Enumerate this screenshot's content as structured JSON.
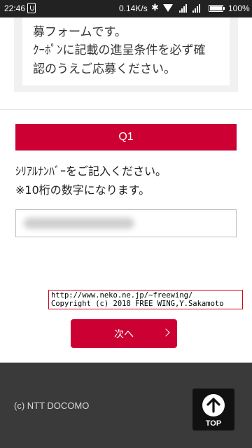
{
  "status_bar": {
    "time": "22:46",
    "network_speed": "0.14K/s",
    "battery": "100%",
    "icons": [
      "notification-icon",
      "bluetooth-icon",
      "wifi-icon",
      "signal-icon",
      "signal-icon",
      "battery-icon"
    ]
  },
  "notice": {
    "lines": [
      "募フォームです。",
      "ｸｰﾎﾟﾝに記載の進呈条件を必ず確",
      "認のうえご応募ください。"
    ]
  },
  "question": {
    "header": "Q1",
    "lines": [
      "ｼﾘｱﾙﾅﾝﾊﾞｰをご記入ください。",
      "※10桁の数字になります。"
    ],
    "input_placeholder": ""
  },
  "watermark": {
    "lines": [
      "http://www.neko.ne.jp/~freewing/",
      "Copyright (c) 2018 FREE WING,Y.Sakamoto"
    ]
  },
  "next_button": {
    "label": "次へ"
  },
  "footer": {
    "copyright": "(c) NTT DOCOMO",
    "top_label": "TOP"
  },
  "colors": {
    "accent": "#cc0033",
    "footer_bg": "#3a3a3a",
    "status_bar_bg": "#222222"
  }
}
